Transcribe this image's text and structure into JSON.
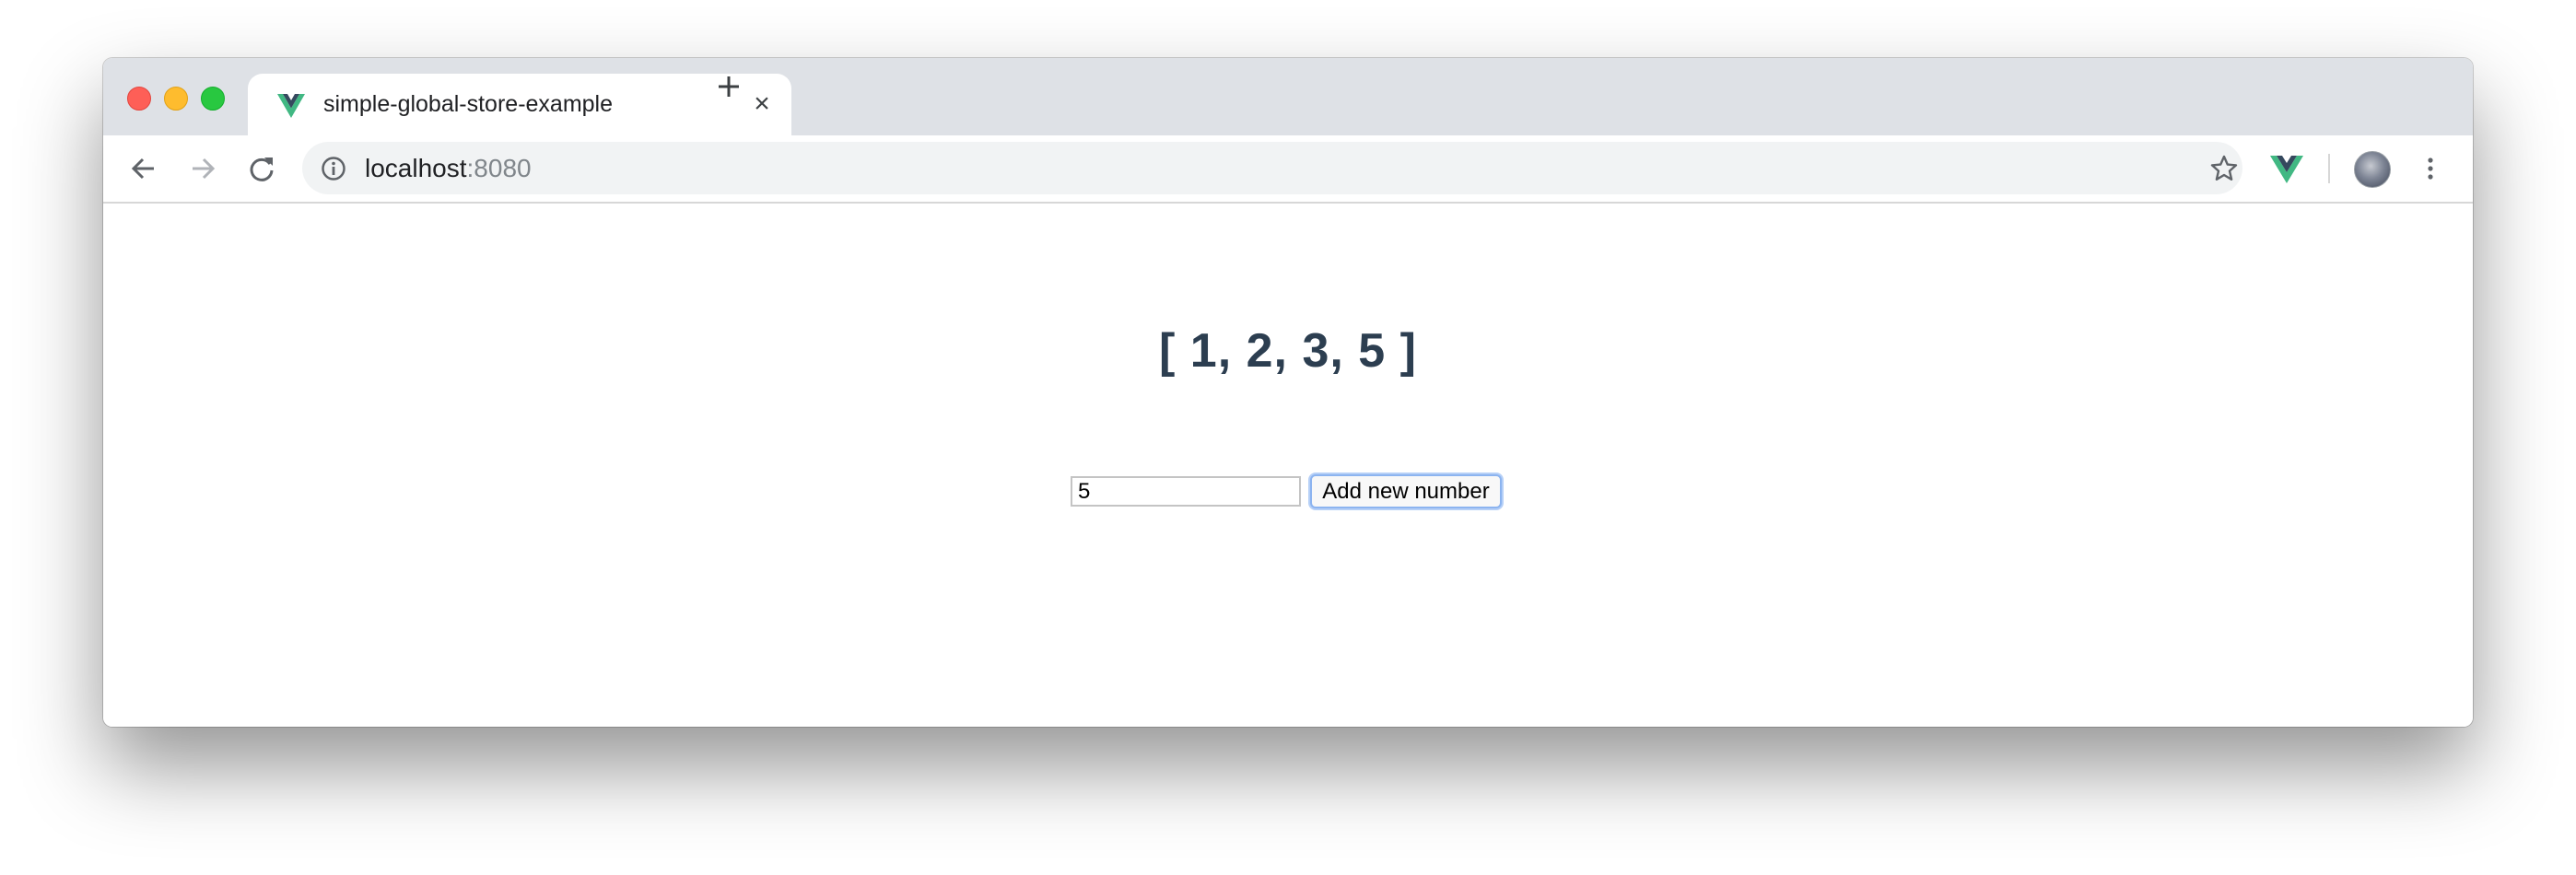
{
  "browser": {
    "tab": {
      "title": "simple-global-store-example",
      "favicon": "vue-logo-icon",
      "close_symbol": "×"
    },
    "new_tab_icon": "plus-icon",
    "address_bar": {
      "host": "localhost",
      "port": ":8080",
      "info_icon": "info-icon"
    },
    "colors": {
      "titlebar": "#dee1e6",
      "omnibox": "#f1f3f4",
      "vue_green": "#41b883",
      "vue_dark": "#35495e"
    }
  },
  "page": {
    "numbers_display": "[ 1, 2, 3, 5 ]",
    "input_value": "5",
    "add_button_label": "Add new number",
    "text_color": "#2c3e50"
  }
}
